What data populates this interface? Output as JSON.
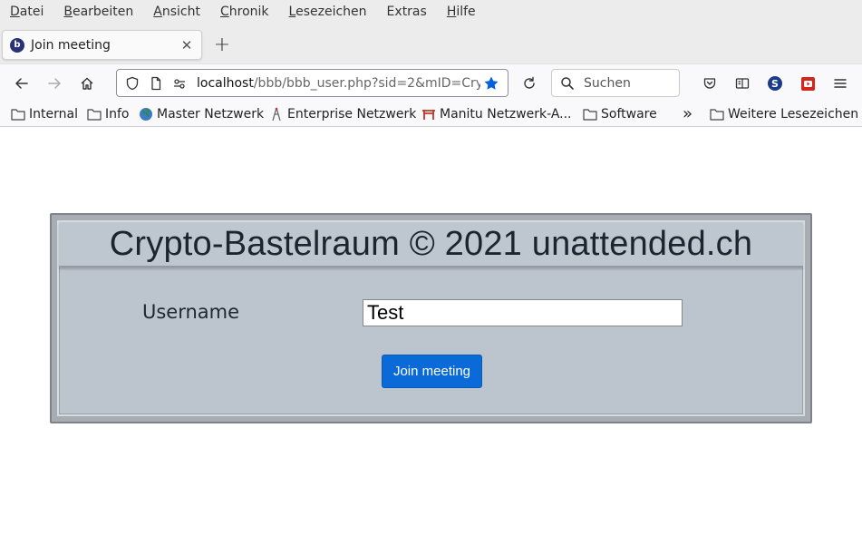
{
  "menubar": {
    "items": [
      {
        "acc": "D",
        "rest": "atei"
      },
      {
        "acc": "B",
        "rest": "earbeiten"
      },
      {
        "acc": "A",
        "rest": "nsicht"
      },
      {
        "acc": "C",
        "rest": "hronik"
      },
      {
        "acc": "L",
        "rest": "esezeichen"
      },
      {
        "acc": "E",
        "rest": "xtras",
        "plain": true
      },
      {
        "acc": "H",
        "rest": "ilfe"
      }
    ]
  },
  "tab": {
    "title": "Join meeting",
    "favicon_letter": "b",
    "close": "✕",
    "new_tab": "+"
  },
  "navbar": {
    "url_host": "localhost",
    "url_path": "/bbb/bbb_user.php?sid=2&mID=Cry",
    "search_placeholder": "Suchen"
  },
  "bookmarks": {
    "items": [
      {
        "label": "Internal",
        "icon": "folder-icon"
      },
      {
        "label": "Info",
        "icon": "folder-icon"
      },
      {
        "label": "Master Netzwerk",
        "icon": "globe-icon"
      },
      {
        "label": "Enterprise Netzwerk",
        "icon": "tower-icon"
      },
      {
        "label": "Manitu Netzwerk-A...",
        "icon": "gate-icon"
      },
      {
        "label": "Software",
        "icon": "folder-icon"
      }
    ],
    "overflow": "»",
    "other_label": "Weitere Lesezeichen"
  },
  "page": {
    "title": "Crypto-Bastelraum © 2021 unattended.ch",
    "username_label": "Username",
    "username_value": "Test",
    "join_button": "Join meeting"
  },
  "colors": {
    "accent": "#0a6bd8",
    "panel_bg": "#bcc4cd",
    "bookmark_star": "#0060df"
  }
}
